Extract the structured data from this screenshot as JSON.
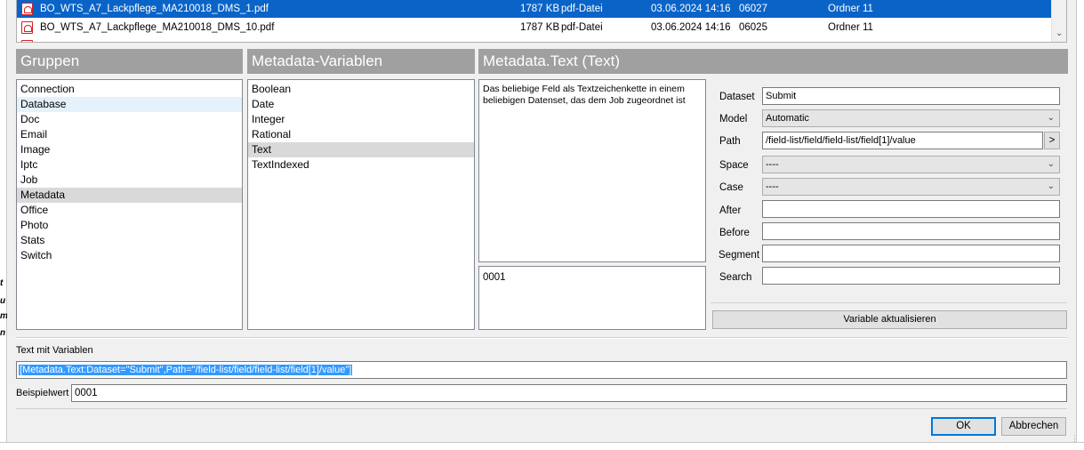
{
  "background": {
    "edge_marks": [
      "t",
      "u",
      "m",
      "n"
    ]
  },
  "file_list": {
    "rows": [
      {
        "name": "BO_WTS_A7_Lackpflege_MA210018_DMS_1.pdf",
        "size": "1787 KB",
        "type": "pdf-Datei",
        "date": "03.06.2024 14:16",
        "id": "06027",
        "folder": "Ordner 11",
        "selected": true
      },
      {
        "name": "BO_WTS_A7_Lackpflege_MA210018_DMS_10.pdf",
        "size": "1787 KB",
        "type": "pdf-Datei",
        "date": "03.06.2024 14:16",
        "id": "06025",
        "folder": "Ordner 11",
        "selected": false
      }
    ]
  },
  "headers": {
    "groups": "Gruppen",
    "variables": "Metadata-Variablen",
    "detail": "Metadata.Text (Text)"
  },
  "groups": {
    "items": [
      "Connection",
      "Database",
      "Doc",
      "Email",
      "Image",
      "Iptc",
      "Job",
      "Metadata",
      "Office",
      "Photo",
      "Stats",
      "Switch"
    ],
    "selected": "Metadata",
    "hover": "Database"
  },
  "variables": {
    "items": [
      "Boolean",
      "Date",
      "Integer",
      "Rational",
      "Text",
      "TextIndexed"
    ],
    "selected": "Text"
  },
  "description": "Das beliebige Feld als Textzeichenkette in einem beliebigen Datenset, das dem Job zugeordnet ist",
  "preview_value": "0001",
  "form": {
    "dataset": {
      "label": "Dataset",
      "value": "Submit"
    },
    "model": {
      "label": "Model",
      "value": "Automatic"
    },
    "path": {
      "label": "Path",
      "value": "/field-list/field/field-list/field[1]/value",
      "browse": ">"
    },
    "space": {
      "label": "Space",
      "value": "----"
    },
    "case": {
      "label": "Case",
      "value": "----"
    },
    "after": {
      "label": "After",
      "value": ""
    },
    "before": {
      "label": "Before",
      "value": ""
    },
    "segment": {
      "label": "Segment",
      "value": ""
    },
    "search": {
      "label": "Search",
      "value": ""
    },
    "update_button": "Variable aktualisieren"
  },
  "text_with_variables": {
    "label": "Text mit Variablen",
    "value": "[Metadata.Text:Dataset=\"Submit\",Path=\"/field-list/field/field-list/field[1]/value\"]"
  },
  "example": {
    "label": "Beispielwert",
    "value": "0001"
  },
  "buttons": {
    "ok": "OK",
    "cancel": "Abbrechen"
  },
  "colors": {
    "selection": "#0a64c8",
    "header_bg": "#a0a0a0",
    "list_selected": "#d9d9d9"
  }
}
